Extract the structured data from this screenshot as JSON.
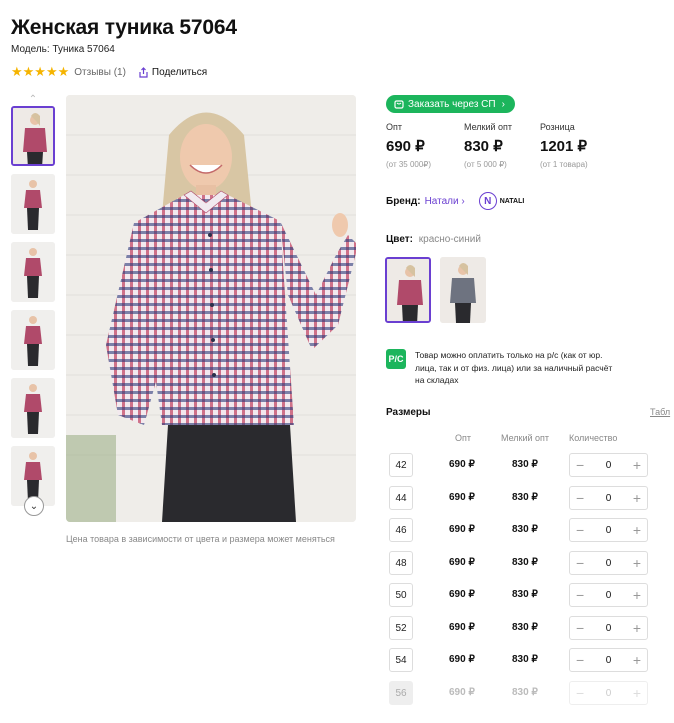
{
  "product": {
    "title": "Женская туника 57064",
    "model": "Модель: Туника 57064",
    "stars": "★★★★★",
    "reviews": "Отзывы (1)",
    "share": "Поделиться"
  },
  "photo_note": "Цена товара в зависимости от цвета и размера может меняться",
  "sp_button": "Заказать через СП",
  "prices": [
    {
      "label": "Опт",
      "value": "690 ₽",
      "sub": "(от 35 000₽)"
    },
    {
      "label": "Мелкий опт",
      "value": "830 ₽",
      "sub": "(от 5 000 ₽)"
    },
    {
      "label": "Розница",
      "value": "1201 ₽",
      "sub": "(от 1 товара)"
    }
  ],
  "brand": {
    "label": "Бренд:",
    "name": "Натали",
    "logo_text": "NATALI"
  },
  "color": {
    "label": "Цвет:",
    "value": "красно-синий"
  },
  "payment_note": "Товар можно оплатить только на р/с (как от юр. лица, так и от физ. лица) или за наличный расчёт на складах",
  "payment_icon": "Р/С",
  "sizes": {
    "title": "Размеры",
    "table_link": "Табл",
    "headers": {
      "opt": "Опт",
      "small": "Мелкий опт",
      "qty": "Количество"
    },
    "rows": [
      {
        "size": "42",
        "opt": "690 ₽",
        "small": "830 ₽",
        "qty": "0"
      },
      {
        "size": "44",
        "opt": "690 ₽",
        "small": "830 ₽",
        "qty": "0"
      },
      {
        "size": "46",
        "opt": "690 ₽",
        "small": "830 ₽",
        "qty": "0"
      },
      {
        "size": "48",
        "opt": "690 ₽",
        "small": "830 ₽",
        "qty": "0"
      },
      {
        "size": "50",
        "opt": "690 ₽",
        "small": "830 ₽",
        "qty": "0"
      },
      {
        "size": "52",
        "opt": "690 ₽",
        "small": "830 ₽",
        "qty": "0"
      },
      {
        "size": "54",
        "opt": "690 ₽",
        "small": "830 ₽",
        "qty": "0"
      },
      {
        "size": "56",
        "opt": "690 ₽",
        "small": "830 ₽",
        "qty": "0"
      }
    ]
  },
  "colors": {
    "accent": "#6a3fd1",
    "green": "#1cb55c",
    "star": "#f5b400"
  }
}
